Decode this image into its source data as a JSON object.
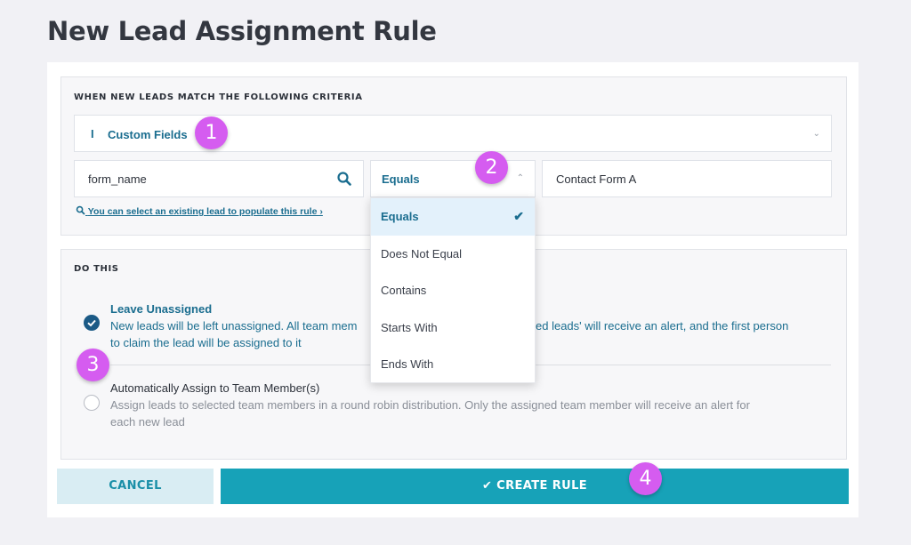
{
  "page": {
    "title": "New Lead Assignment Rule"
  },
  "criteria": {
    "heading": "WHEN NEW LEADS MATCH THE FOLLOWING CRITERIA",
    "field_type": {
      "icon": "text-cursor-icon",
      "label": "Custom Fields"
    },
    "field_name": "form_name",
    "operator": {
      "selected": "Equals",
      "options": [
        "Equals",
        "Does Not Equal",
        "Contains",
        "Starts With",
        "Ends With"
      ]
    },
    "value": "Contact Form A",
    "lookup_link": "You can select an existing lead to populate this rule ›"
  },
  "action": {
    "heading": "DO THIS",
    "options": [
      {
        "title": "Leave Unassigned",
        "desc_line1": "New leads will be left unassigned. All team mem",
        "desc_line1b": "ed leads' will receive an alert, and the first person",
        "desc_line2": "to claim the lead will be assigned to it",
        "checked": true
      },
      {
        "title": "Automatically Assign to Team Member(s)",
        "desc_line1": "Assign leads to selected team members in a round robin distribution. Only the assigned team member will receive an alert for",
        "desc_line2": "each new lead",
        "checked": false
      }
    ]
  },
  "buttons": {
    "cancel": "CANCEL",
    "create": "CREATE RULE"
  },
  "markers": [
    "1",
    "2",
    "3",
    "4"
  ],
  "colors": {
    "accent": "#17a2b8",
    "link": "#1a6d8f",
    "marker": "#d55cf0"
  }
}
